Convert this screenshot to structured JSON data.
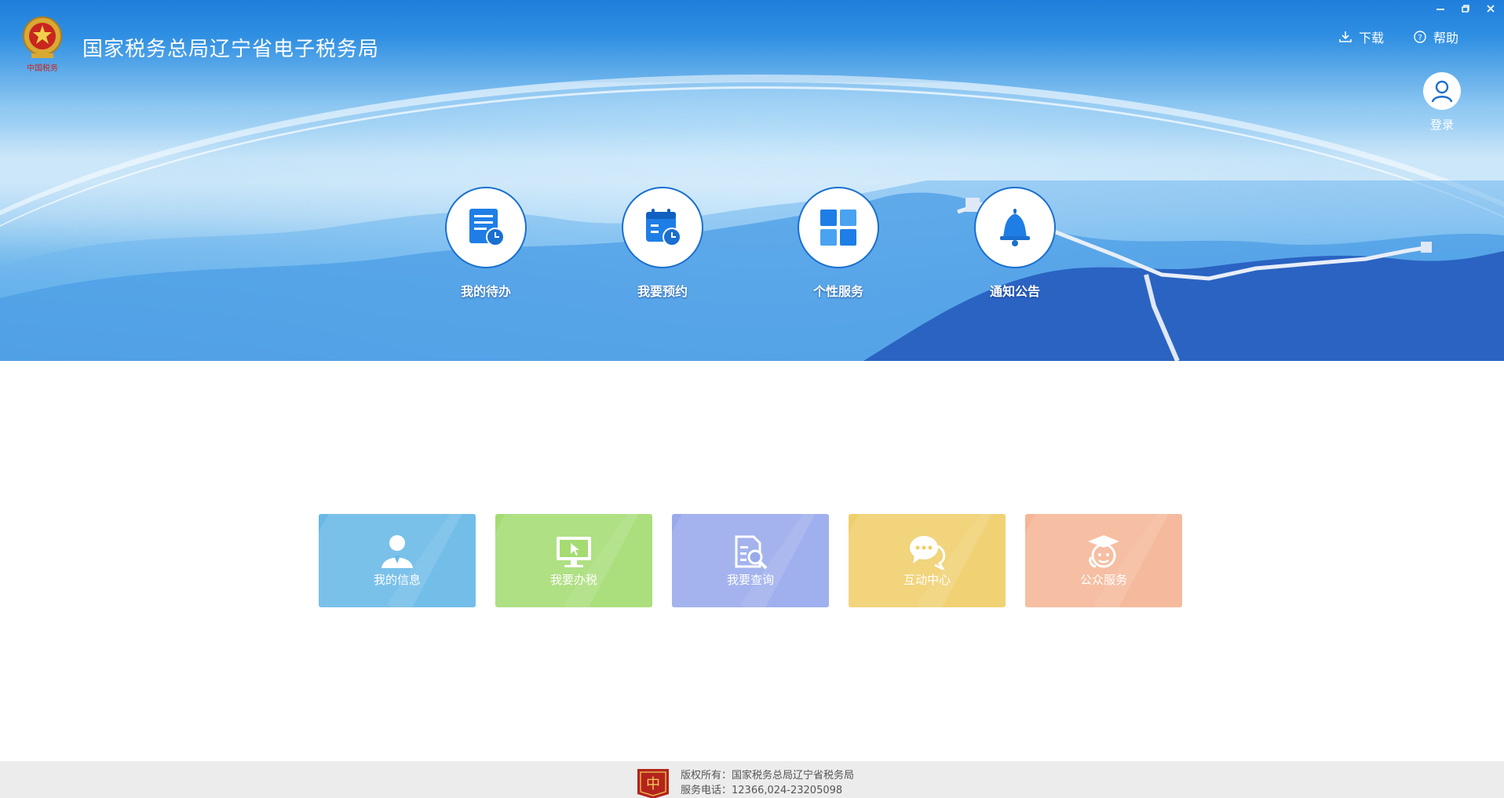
{
  "header": {
    "title": "国家税务总局辽宁省电子税务局",
    "download_label": "下载",
    "help_label": "帮助",
    "login_label": "登录"
  },
  "window_controls": [
    "minimize",
    "restore",
    "close"
  ],
  "quick_nav": [
    {
      "label": "我的待办",
      "icon": "todo-list-icon"
    },
    {
      "label": "我要预约",
      "icon": "calendar-clock-icon"
    },
    {
      "label": "个性服务",
      "icon": "grid-icon"
    },
    {
      "label": "通知公告",
      "icon": "bell-icon"
    }
  ],
  "tiles": [
    {
      "label": "我的信息",
      "icon": "user-icon",
      "color": "#68b9e8"
    },
    {
      "label": "我要办税",
      "icon": "monitor-icon",
      "color": "#a4dc72"
    },
    {
      "label": "我要查询",
      "icon": "search-document-icon",
      "color": "#98a9ec"
    },
    {
      "label": "互动中心",
      "icon": "chat-icon",
      "color": "#efcf6a"
    },
    {
      "label": "公众服务",
      "icon": "graduate-icon",
      "color": "#f5b596"
    }
  ],
  "footer": {
    "copyright": "版权所有：国家税务总局辽宁省税务局",
    "phone": "服务电话：12366,024-23205098"
  },
  "colors": {
    "brand_blue": "#1f7edb",
    "icon_blue": "#1a6fd0",
    "footer_bg": "#ececec"
  }
}
